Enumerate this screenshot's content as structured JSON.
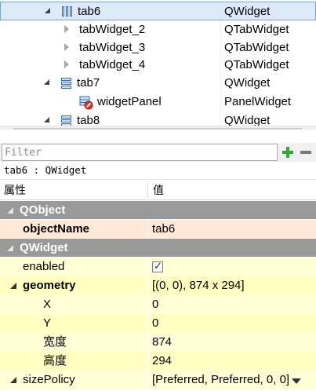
{
  "tree": {
    "rows": [
      {
        "name": "tab6",
        "class": "QWidget"
      },
      {
        "name": "tabWidget_2",
        "class": "QTabWidget"
      },
      {
        "name": "tabWidget_3",
        "class": "QTabWidget"
      },
      {
        "name": "tabWidget_4",
        "class": "QTabWidget"
      },
      {
        "name": "tab7",
        "class": "QWidget"
      },
      {
        "name": "widgetPanel",
        "class": "PanelWidget"
      },
      {
        "name": "tab8",
        "class": "QWidget"
      }
    ]
  },
  "filter": {
    "placeholder": "Filter"
  },
  "object_info": "tab6 : QWidget",
  "properties": {
    "header": {
      "property": "属性",
      "value": "值"
    },
    "rows": [
      {
        "name": "QObject",
        "value": ""
      },
      {
        "name": "objectName",
        "value": "tab6"
      },
      {
        "name": "QWidget",
        "value": ""
      },
      {
        "name": "enabled",
        "value": ""
      },
      {
        "name": "geometry",
        "value": "[(0, 0), 874 x 294]"
      },
      {
        "name": "X",
        "value": "0"
      },
      {
        "name": "Y",
        "value": "0"
      },
      {
        "name": "宽度",
        "value": "874"
      },
      {
        "name": "高度",
        "value": "294"
      },
      {
        "name": "sizePolicy",
        "value": "[Preferred, Preferred, 0, 0]"
      }
    ]
  }
}
